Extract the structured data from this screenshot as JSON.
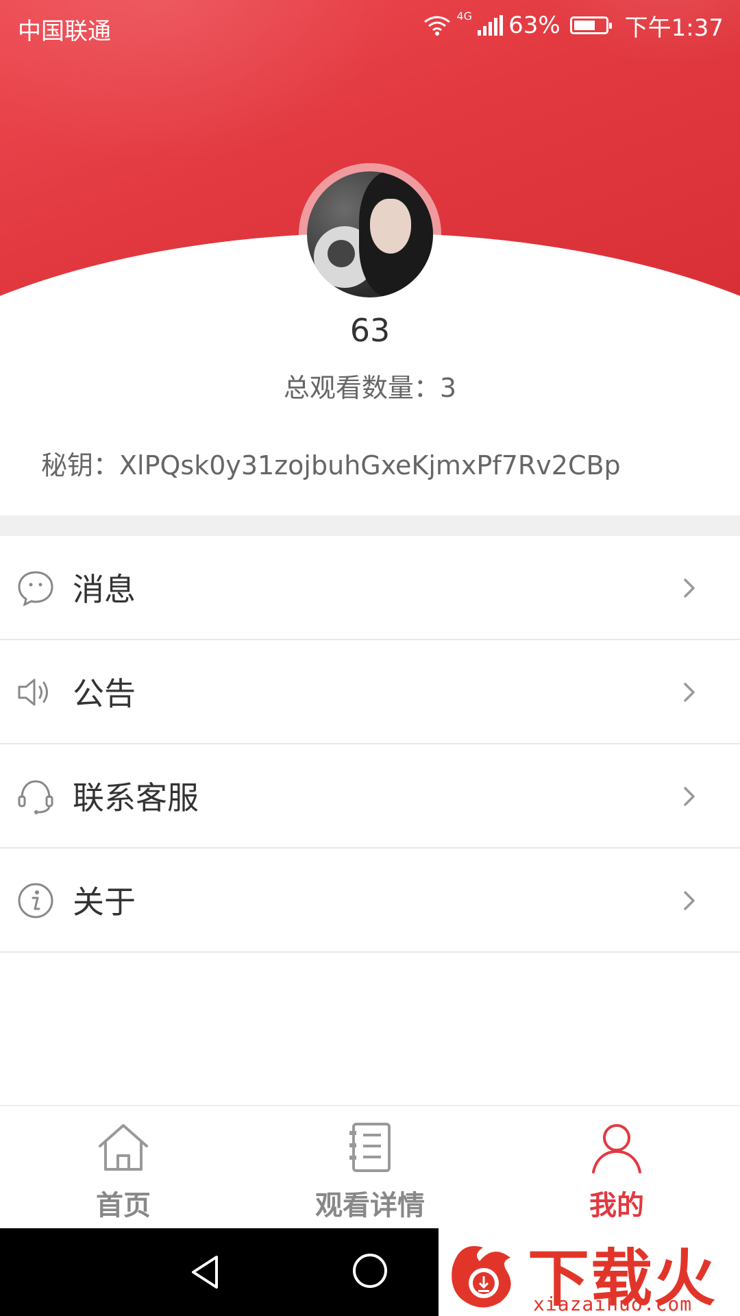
{
  "status_bar": {
    "carrier": "中国联通",
    "network": "4G",
    "battery": "63%",
    "time": "下午1:37"
  },
  "profile": {
    "username": "63",
    "total_views": "总观看数量：3",
    "secret_key": "秘钥：XlPQsk0y31zojbuhGxeKjmxPf7Rv2CBp"
  },
  "menu": {
    "items": [
      {
        "label": "消息",
        "icon": "message-bubble-icon"
      },
      {
        "label": "公告",
        "icon": "speaker-icon"
      },
      {
        "label": "联系客服",
        "icon": "headset-icon"
      },
      {
        "label": "关于",
        "icon": "info-icon"
      }
    ]
  },
  "tabs": [
    {
      "label": "首页",
      "icon": "home-icon",
      "active": false
    },
    {
      "label": "观看详情",
      "icon": "notebook-icon",
      "active": false
    },
    {
      "label": "我的",
      "icon": "person-icon",
      "active": true
    }
  ],
  "watermark": {
    "title": "下载火",
    "subtitle": "xiazaihuo.com"
  },
  "colors": {
    "primary": "#e23940",
    "active_tab": "#e23940",
    "inactive_tab": "#888888",
    "text": "#333333",
    "subtext": "#666666"
  }
}
